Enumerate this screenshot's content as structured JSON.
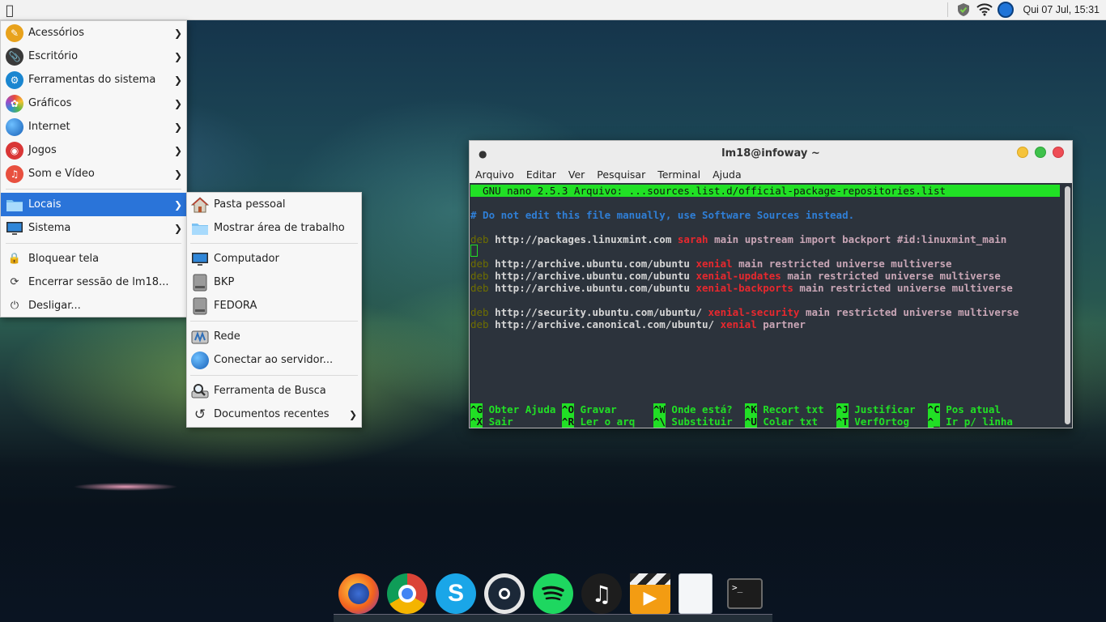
{
  "top_panel": {
    "clock": "Qui 07 Jul, 15:31"
  },
  "main_menu": {
    "items": [
      {
        "label": "Acessórios",
        "icon": "accessories-icon"
      },
      {
        "label": "Escritório",
        "icon": "office-icon"
      },
      {
        "label": "Ferramentas do sistema",
        "icon": "system-tools-icon"
      },
      {
        "label": "Gráficos",
        "icon": "graphics-icon"
      },
      {
        "label": "Internet",
        "icon": "internet-icon"
      },
      {
        "label": "Jogos",
        "icon": "games-icon"
      },
      {
        "label": "Som e Vídeo",
        "icon": "multimedia-icon"
      },
      {
        "label": "Locais",
        "icon": "folder-icon"
      },
      {
        "label": "Sistema",
        "icon": "monitor-icon"
      }
    ],
    "actions": [
      {
        "label": "Bloquear tela",
        "icon": "lock-icon"
      },
      {
        "label": "Encerrar sessão de lm18...",
        "icon": "logout-icon"
      },
      {
        "label": "Desligar...",
        "icon": "power-icon"
      }
    ]
  },
  "sub_menu": {
    "items": [
      {
        "label": "Pasta pessoal"
      },
      {
        "label": "Mostrar área de trabalho"
      },
      {
        "label": "Computador"
      },
      {
        "label": "BKP"
      },
      {
        "label": "FEDORA"
      },
      {
        "label": "Rede"
      },
      {
        "label": "Conectar ao servidor..."
      },
      {
        "label": "Ferramenta de Busca"
      },
      {
        "label": "Documentos recentes"
      }
    ]
  },
  "terminal": {
    "title": "lm18@infoway ~",
    "menu": [
      "Arquivo",
      "Editar",
      "Ver",
      "Pesquisar",
      "Terminal",
      "Ajuda"
    ],
    "nano_header": "  GNU nano 2.5.3 Arquivo: ...sources.list.d/official-package-repositories.list",
    "comment": "# Do not edit this file manually, use Software Sources instead.",
    "lines": [
      {
        "deb": "deb",
        "url": "http://packages.linuxmint.com",
        "suite": "sarah",
        "comp": "main upstream import backport #id:linuxmint_main"
      },
      {
        "deb": "deb",
        "url": "http://archive.ubuntu.com/ubuntu",
        "suite": "xenial",
        "comp": "main restricted universe multiverse"
      },
      {
        "deb": "deb",
        "url": "http://archive.ubuntu.com/ubuntu",
        "suite": "xenial-updates",
        "comp": "main restricted universe multiverse"
      },
      {
        "deb": "deb",
        "url": "http://archive.ubuntu.com/ubuntu",
        "suite": "xenial-backports",
        "comp": "main restricted universe multiverse"
      },
      {
        "deb": "deb",
        "url": "http://security.ubuntu.com/ubuntu/",
        "suite": "xenial-security",
        "comp": "main restricted universe multiverse"
      },
      {
        "deb": "deb",
        "url": "http://archive.canonical.com/ubuntu/",
        "suite": "xenial",
        "comp": "partner"
      }
    ],
    "shortcuts_row1": [
      {
        "key": "^G",
        "label": "Obter Ajuda"
      },
      {
        "key": "^O",
        "label": "Gravar"
      },
      {
        "key": "^W",
        "label": "Onde está?"
      },
      {
        "key": "^K",
        "label": "Recort txt"
      },
      {
        "key": "^J",
        "label": "Justificar"
      },
      {
        "key": "^C",
        "label": "Pos atual"
      }
    ],
    "shortcuts_row2": [
      {
        "key": "^X",
        "label": "Sair"
      },
      {
        "key": "^R",
        "label": "Ler o arq"
      },
      {
        "key": "^\\",
        "label": "Substituir"
      },
      {
        "key": "^U",
        "label": "Colar txt"
      },
      {
        "key": "^T",
        "label": "VerfOrtog"
      },
      {
        "key": "^_",
        "label": "Ir p/ linha"
      }
    ]
  },
  "dock": {
    "apps": [
      "firefox-icon",
      "chrome-icon",
      "skype-icon",
      "steam-icon",
      "spotify-icon",
      "music-icon",
      "video-editor-icon",
      "text-editor-icon",
      "terminal-icon"
    ]
  }
}
